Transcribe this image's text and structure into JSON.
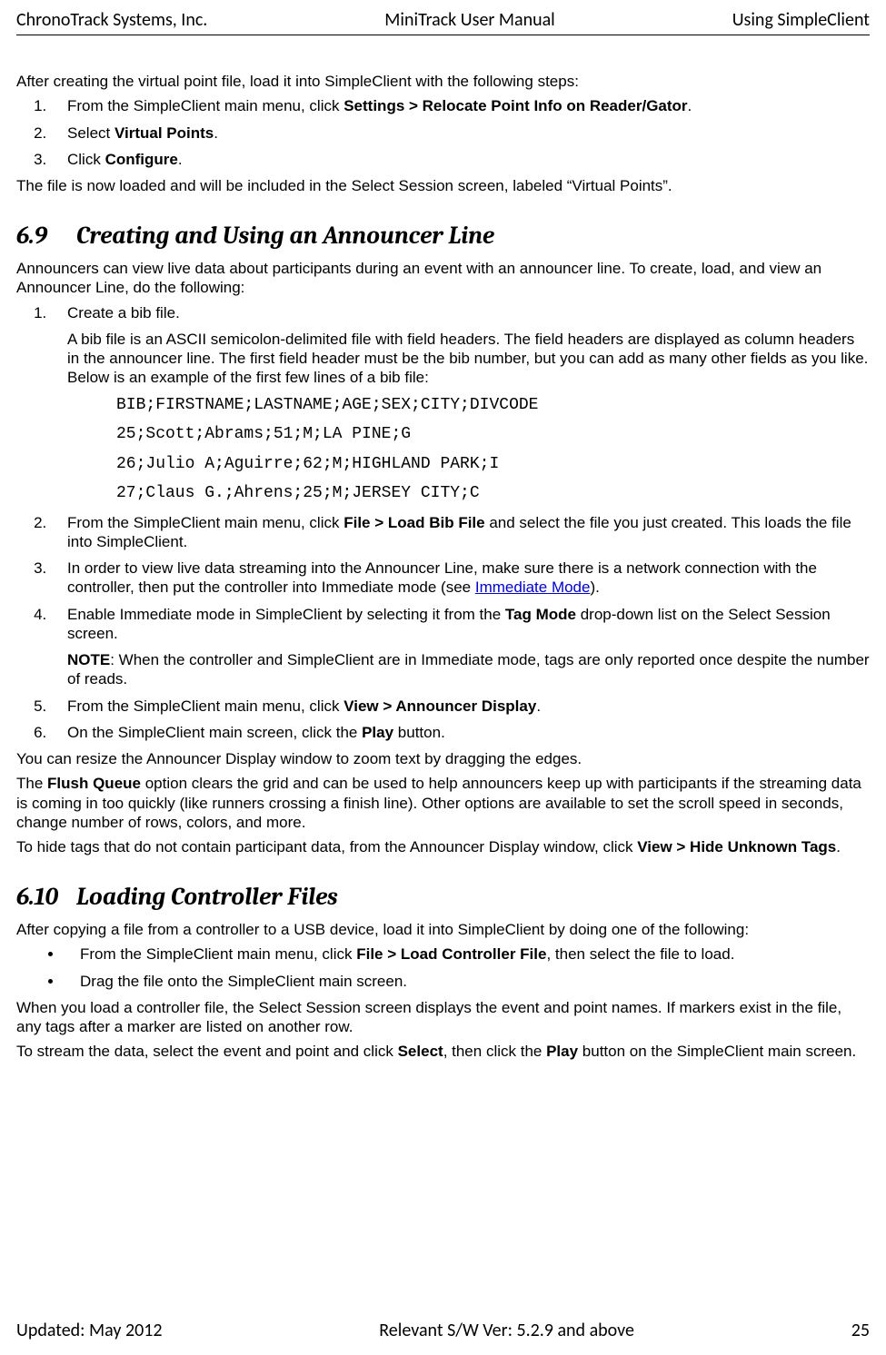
{
  "header": {
    "left": "ChronoTrack Systems, Inc.",
    "center": "MiniTrack User Manual",
    "right": "Using SimpleClient"
  },
  "footer": {
    "left": "Updated: May 2012",
    "center": "Relevant S/W Ver: 5.2.9 and above",
    "right": "25"
  },
  "intro_paragraph": "After creating the virtual point file, load it into SimpleClient with the following steps:",
  "intro_steps": {
    "s1_pre": "From the SimpleClient main menu, click ",
    "s1_bold": "Settings > Relocate Point Info on Reader/Gator",
    "s1_post": ".",
    "s2_pre": "Select ",
    "s2_bold": "Virtual Points",
    "s2_post": ".",
    "s3_pre": "Click ",
    "s3_bold": "Configure",
    "s3_post": "."
  },
  "intro_after": "The file is now loaded and will be included in the Select Session screen, labeled “Virtual Points”.",
  "h69_num": "6.9",
  "h69_title": "Creating and Using an Announcer Line",
  "h69_intro": "Announcers can view live data about participants during an event with an announcer line. To create, load, and view an Announcer Line, do the following:",
  "h69_steps": {
    "s1": "Create a bib file.",
    "s1_para": "A bib file is an ASCII semicolon-delimited file with field headers. The field headers are displayed as column headers in the announcer line. The first field header must be the bib number, but you can add as many other fields as you like. Below is an example of the first few lines of a bib file:",
    "code1": "BIB;FIRSTNAME;LASTNAME;AGE;SEX;CITY;DIVCODE",
    "code2": "25;Scott;Abrams;51;M;LA PINE;G",
    "code3": "26;Julio A;Aguirre;62;M;HIGHLAND PARK;I",
    "code4": "27;Claus G.;Ahrens;25;M;JERSEY CITY;C",
    "s2_pre": "From the SimpleClient main menu, click ",
    "s2_bold": "File > Load Bib File",
    "s2_post": " and select the file you just created. This loads the file into SimpleClient.",
    "s3_pre": "In order to view live data streaming into the Announcer Line, make sure there is a network connection with the controller, then put the controller into Immediate mode (see ",
    "s3_link": "Immediate Mode",
    "s3_post": ").",
    "s4_pre": "Enable Immediate mode in SimpleClient by selecting it from the ",
    "s4_bold": "Tag Mode",
    "s4_post": " drop-down list on the Select Session screen.",
    "s4_note_bold": "NOTE",
    "s4_note": ": When the controller and SimpleClient are in Immediate mode, tags are only reported once despite the number of reads.",
    "s5_pre": "From the SimpleClient main menu, click ",
    "s5_bold": "View > Announcer Display",
    "s5_post": ".",
    "s6_pre": "On the SimpleClient main screen, click the ",
    "s6_bold": "Play",
    "s6_post": " button."
  },
  "h69_p1": "You can resize the Announcer Display window to zoom text by dragging the edges.",
  "h69_p2_pre": "The ",
  "h69_p2_bold": "Flush Queue",
  "h69_p2_post": " option clears the grid and can be used to help announcers keep up with participants if the streaming data is coming in too quickly (like runners crossing a finish line). Other options are available to set the scroll speed in seconds, change number of rows, colors, and more.",
  "h69_p3_pre": "To hide tags that do not contain participant data, from the Announcer Display window, click ",
  "h69_p3_bold": "View > Hide Unknown Tags",
  "h69_p3_post": ".",
  "h610_num": "6.10",
  "h610_title": "Loading Controller Files",
  "h610_intro": "After copying a file from a controller to a USB device, load it into SimpleClient by doing one of the following:",
  "h610_bullets": {
    "b1_pre": "From the SimpleClient main menu, click ",
    "b1_bold": "File > Load Controller File",
    "b1_post": ", then select the file to load.",
    "b2": "Drag the file onto the SimpleClient main screen."
  },
  "h610_p1": "When you load a controller file, the Select Session screen displays the event and point names. If markers exist in the file, any tags after a marker are listed on another row.",
  "h610_p2_pre": "To stream the data, select the event and point and click ",
  "h610_p2_bold1": "Select",
  "h610_p2_mid": ", then click the ",
  "h610_p2_bold2": "Play",
  "h610_p2_post": " button on the SimpleClient main screen."
}
